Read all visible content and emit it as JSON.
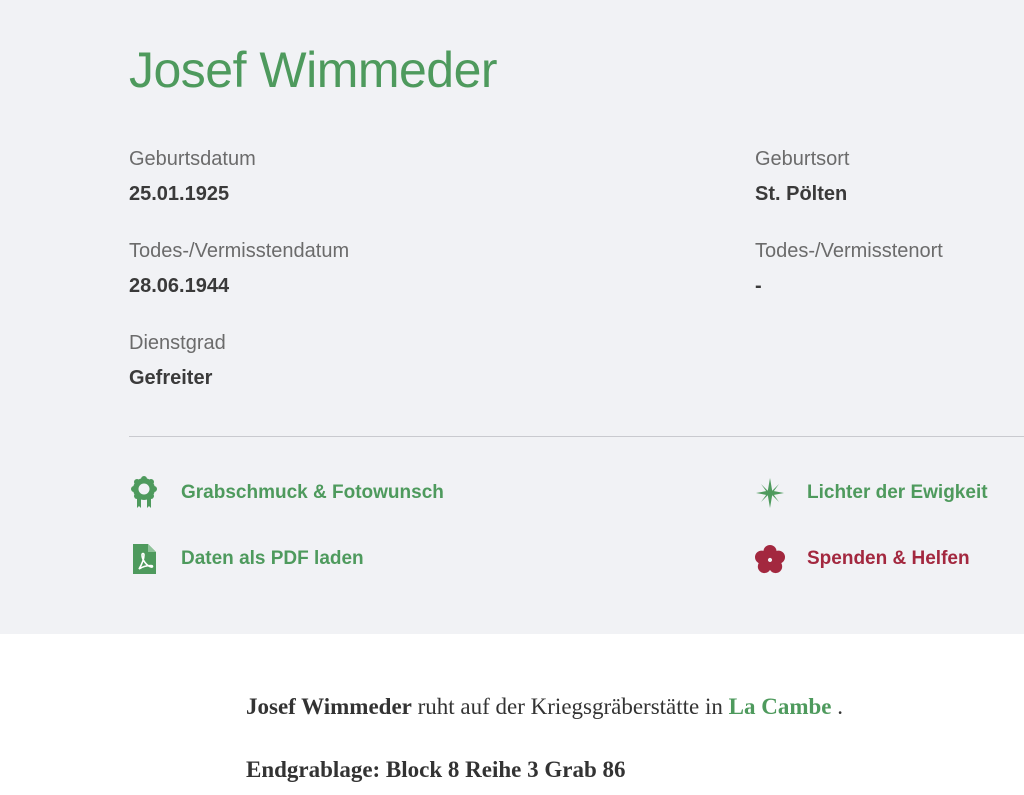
{
  "person": {
    "name": "Josef Wimmeder"
  },
  "fields": {
    "birth_date": {
      "label": "Geburtsdatum",
      "value": "25.01.1925"
    },
    "birth_place": {
      "label": "Geburtsort",
      "value": "St. Pölten"
    },
    "death_date": {
      "label": "Todes-/Vermisstendatum",
      "value": "28.06.1944"
    },
    "death_place": {
      "label": "Todes-/Vermisstenort",
      "value": "-"
    },
    "rank": {
      "label": "Dienstgrad",
      "value": "Gefreiter"
    }
  },
  "actions": {
    "grave_decoration": {
      "label": "Grabschmuck & Fotowunsch",
      "icon": "rosette-icon"
    },
    "eternal_lights": {
      "label": "Lichter der Ewigkeit",
      "icon": "sparkle-star-icon"
    },
    "pdf": {
      "label": "Daten als PDF laden",
      "icon": "pdf-file-icon"
    },
    "donate": {
      "label": "Spenden & Helfen",
      "icon": "flower-icon"
    }
  },
  "burial": {
    "name": "Josef Wimmeder",
    "text": "ruht auf der Kriegsgräberstätte in",
    "cemetery": "La Cambe",
    "period": ".",
    "grave_location": "Endgrablage: Block 8 Reihe 3 Grab 86"
  },
  "colors": {
    "accent_green": "#4e9a5d",
    "accent_red": "#a3283f",
    "panel_bg": "#f1f2f5"
  }
}
